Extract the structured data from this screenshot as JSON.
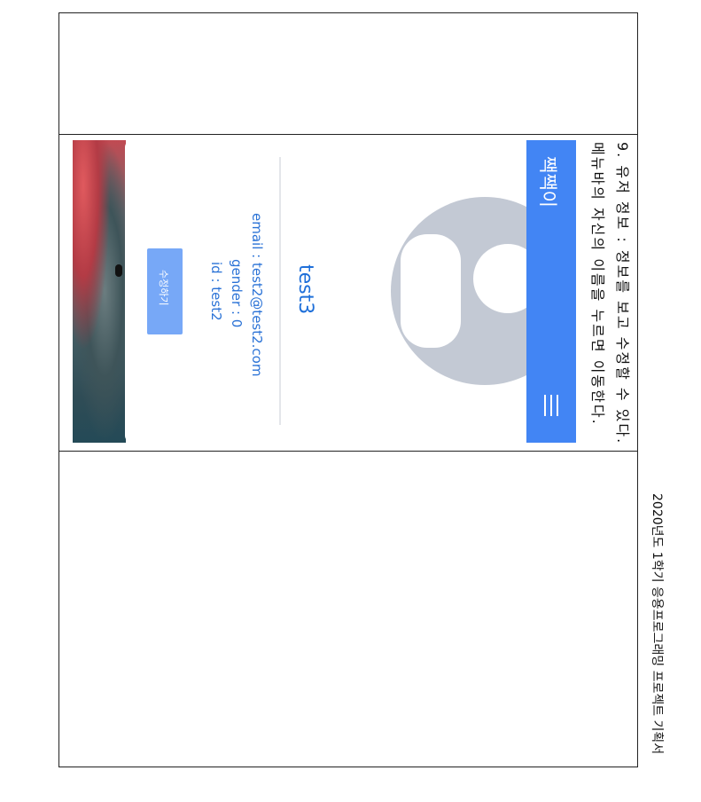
{
  "document": {
    "step_text": "9. 유저 정보 : 정보를 보고 수정할 수 있다.",
    "step_subtext": "메뉴바의 자신의 이름을 누르면 이동한다.",
    "footer": "2020년도 1학기 응용프로그래밍 프로젝트 기획서"
  },
  "app": {
    "title": "짹짹이",
    "menu_icon": "hamburger-icon",
    "accent_color": "#4285f4"
  },
  "profile": {
    "avatar_icon": "default-avatar-icon",
    "name": "test3",
    "email": "email : test2@test2.com",
    "gender": "gender : 0",
    "id": "id : test2",
    "edit_label": "수정하기"
  }
}
